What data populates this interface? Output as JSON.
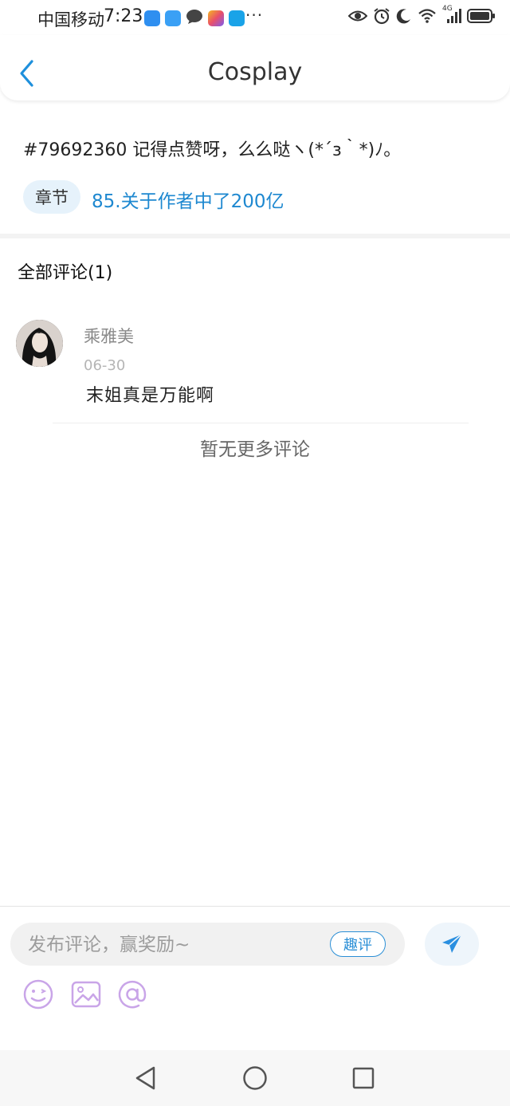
{
  "status_bar": {
    "carrier": "中国移动",
    "time": "7:23",
    "overflow": "···",
    "network": "4G"
  },
  "header": {
    "title": "Cosplay",
    "back_icon": "chevron-left-icon"
  },
  "post": {
    "text": "#79692360 记得点赞呀，么么哒ヽ(*´з｀*)ﾉ。",
    "tag_label": "章节",
    "chapter_link": "85.关于作者中了200亿"
  },
  "comments": {
    "heading": "全部评论(1)",
    "items": [
      {
        "username": "乘雅美",
        "date": "06-30",
        "text": "末姐真是万能啊"
      }
    ],
    "no_more": "暂无更多评论"
  },
  "composer": {
    "placeholder": "发布评论，赢奖励~",
    "quick_button": "趣评",
    "send_icon": "paper-plane-icon",
    "tools": [
      "emoji-icon",
      "image-icon",
      "at-icon"
    ]
  },
  "colors": {
    "accent": "#2b8fd6",
    "link": "#1e88d0",
    "tool_purple": "#c9a5e8"
  }
}
